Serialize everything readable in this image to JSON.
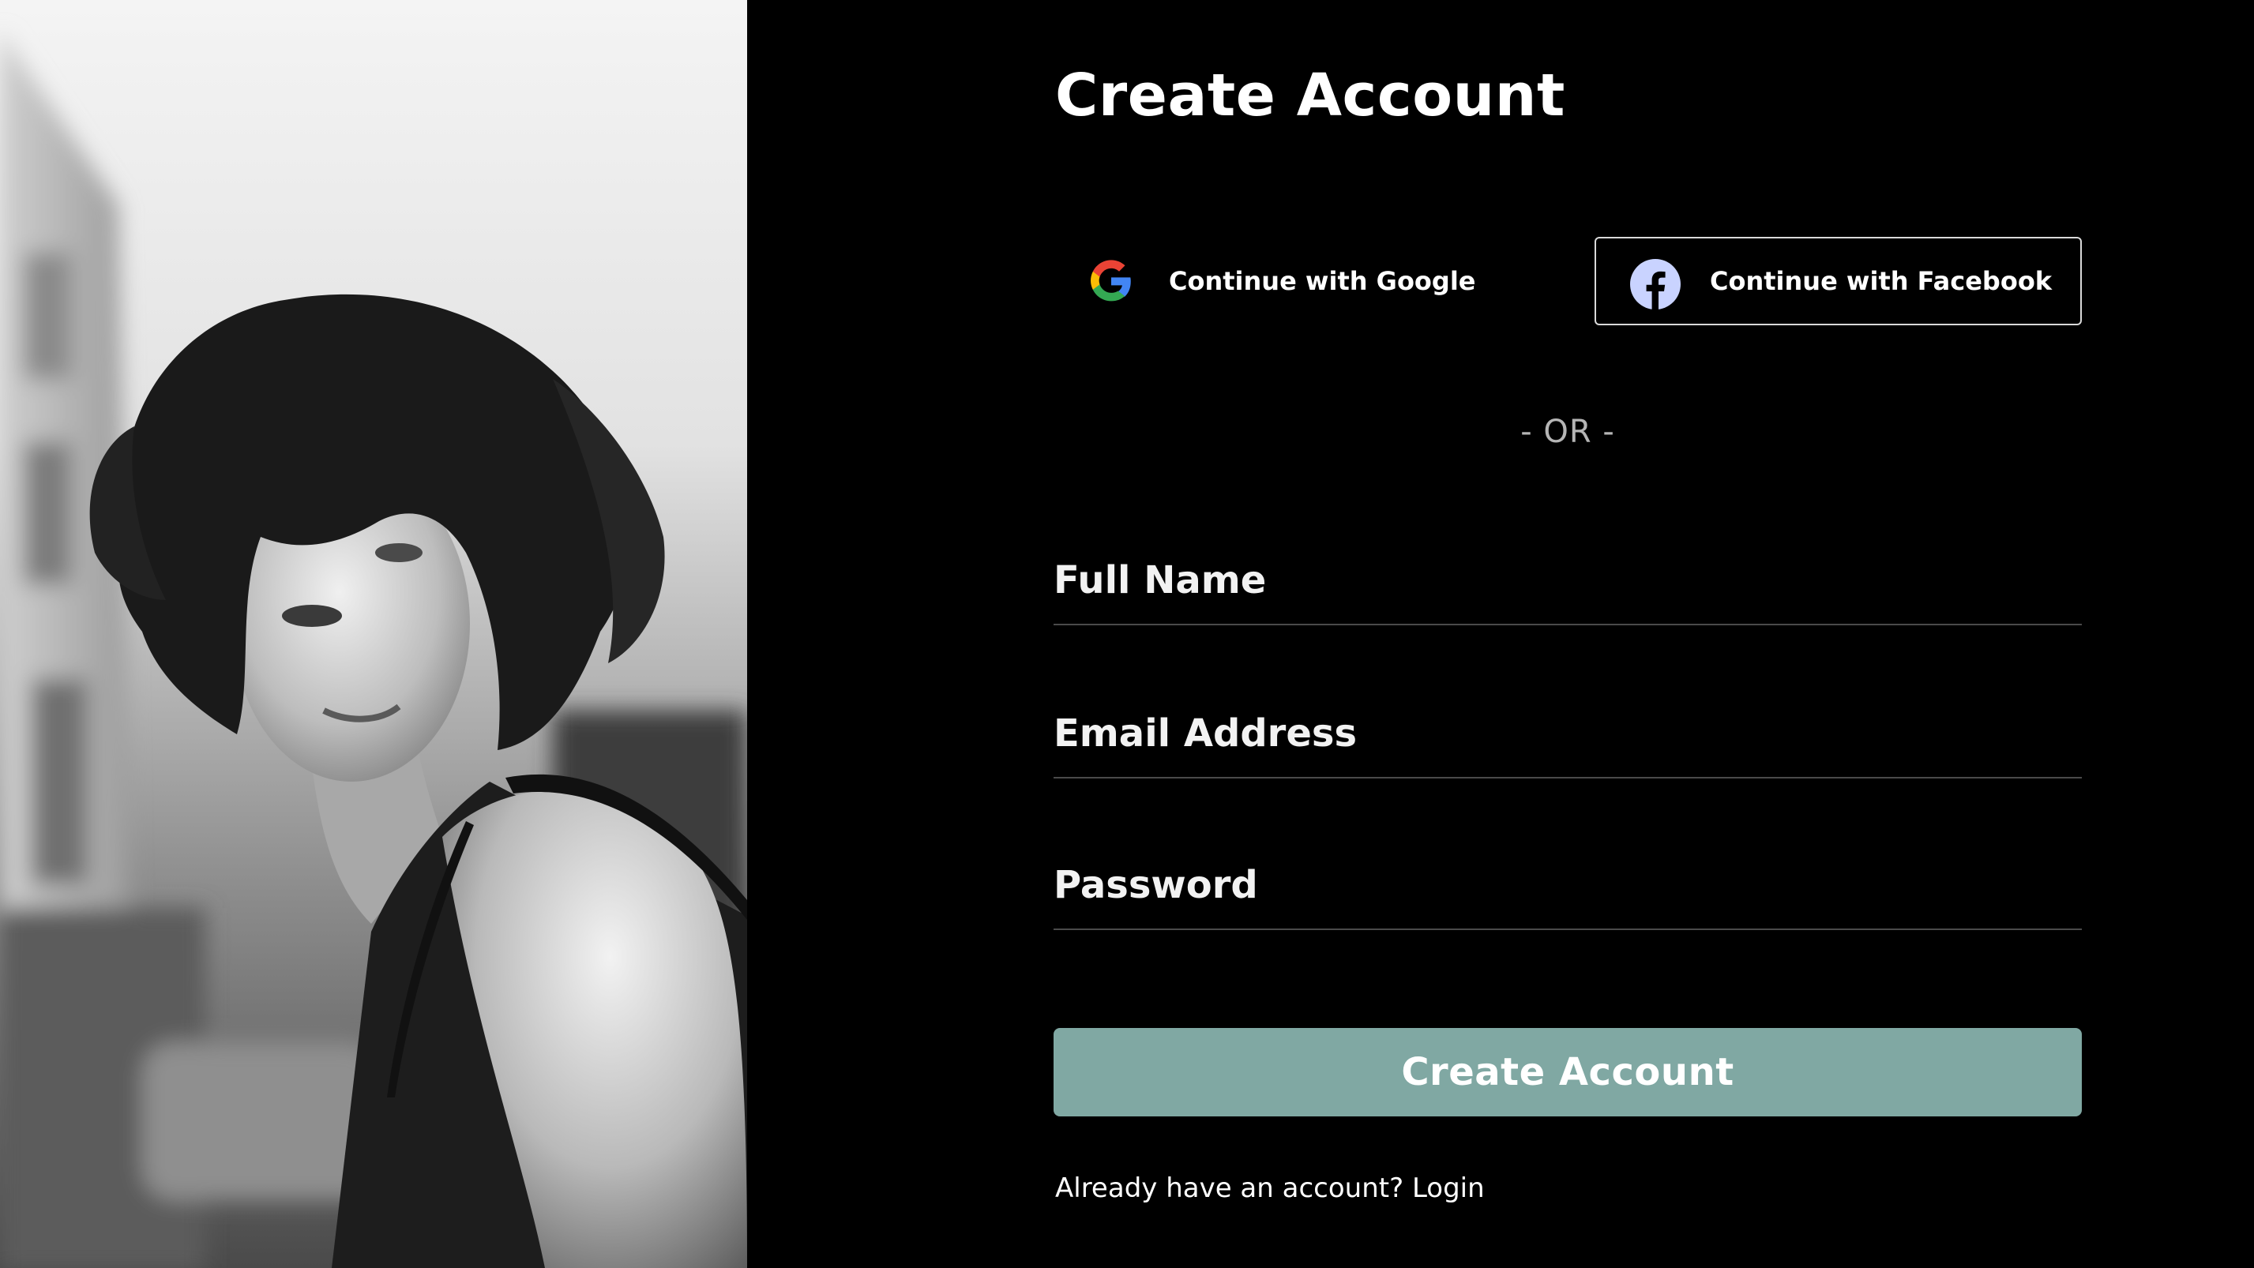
{
  "photo": {
    "alt_icon": "portrait-photo"
  },
  "form": {
    "title": "Create Account",
    "social": {
      "google_label": "Continue with Google",
      "google_icon": "google-icon",
      "facebook_label": "Continue with Facebook",
      "facebook_icon": "facebook-icon"
    },
    "divider": "- OR -",
    "fields": {
      "full_name_placeholder": "Full Name",
      "email_placeholder": "Email Address",
      "password_placeholder": "Password"
    },
    "submit_label": "Create Account",
    "login_prompt": "Already have an account?",
    "login_link": "Login"
  },
  "colors": {
    "background": "#000000",
    "accent_button": "#80a8a3",
    "facebook_badge": "#c9d3ff",
    "text": "#ffffff",
    "divider_text": "#b5b5b5"
  }
}
